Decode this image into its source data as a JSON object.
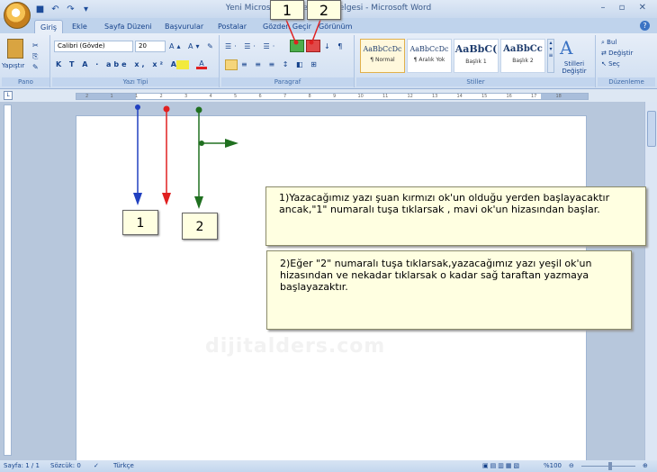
{
  "window": {
    "title": "Yeni Microsoft Office Word Belgesi - Microsoft Word",
    "controls": "– ▫ ✕"
  },
  "qat_icons": [
    "save-icon",
    "undo-icon",
    "redo-icon",
    "customize-icon"
  ],
  "tabs": [
    "Giriş",
    "Ekle",
    "Sayfa Düzeni",
    "Başvurular",
    "Postalar",
    "Gözden Geçir",
    "Görünüm"
  ],
  "ribbon": {
    "clipboard": {
      "paste_label": "Yapıştır",
      "group": "Pano"
    },
    "font": {
      "name": "Calibri (Gövde)",
      "size": "20",
      "group": "Yazı Tipi",
      "row2": "K  T  A ·  abe  x,  x²  Aa"
    },
    "paragraph": {
      "group": "Paragraf"
    },
    "styles": {
      "group": "Stiller",
      "items": [
        {
          "sample": "AaBbCcDc",
          "name": "¶ Normal"
        },
        {
          "sample": "AaBbCcDc",
          "name": "¶ Aralık Yok"
        },
        {
          "sample": "AaBbC(",
          "name": "Başlık 1"
        },
        {
          "sample": "AaBbCc",
          "name": "Başlık 2"
        }
      ],
      "change_label": "Stilleri Değiştir"
    },
    "editing": {
      "group": "Düzenleme",
      "find": "Bul",
      "replace": "Değiştir",
      "select": "Seç"
    }
  },
  "ruler_ticks": [
    "2",
    "1",
    "1",
    "2",
    "3",
    "4",
    "5",
    "6",
    "7",
    "8",
    "9",
    "10",
    "11",
    "12",
    "13",
    "14",
    "15",
    "16",
    "17",
    "18"
  ],
  "callouts": {
    "one": "1)Yazacağımız yazı şuan kırmızı ok'un olduğu yerden başlayacaktır ancak,\"1\" numaralı tuşa tıklarsak , mavi ok'un hizasından başlar.",
    "two": "2)Eğer \"2\" numaralı tuşa tıklarsak,yazacağımız yazı yeşil ok'un hizasından ve nekadar tıklarsak o kadar sağ taraftan yazmaya başlayazaktır."
  },
  "labels": {
    "top_one": "1",
    "top_two": "2",
    "page_one": "1",
    "page_two": "2"
  },
  "watermark": "dijitalders.com",
  "status": {
    "page": "Sayfa: 1 / 1",
    "words": "Sözcük: 0",
    "language": "Türkçe",
    "zoom": "%100"
  },
  "colors": {
    "blue_arrow": "#2040c0",
    "red_arrow": "#e02020",
    "green_arrow": "#207020",
    "callout_bg": "#ffffe1"
  }
}
